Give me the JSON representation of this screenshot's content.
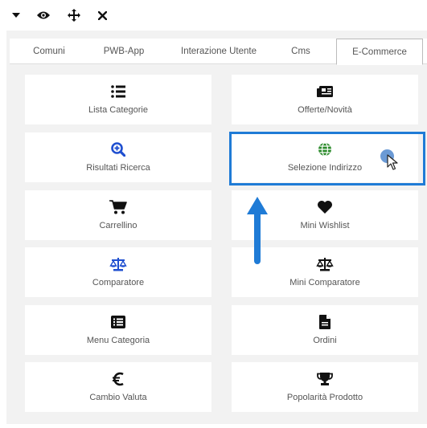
{
  "toolbar": {
    "icons": [
      "caret-down-icon",
      "eye-icon",
      "move-icon",
      "close-icon"
    ]
  },
  "tabs": [
    {
      "label": "Comuni"
    },
    {
      "label": "PWB-App"
    },
    {
      "label": "Interazione Utente"
    },
    {
      "label": "Cms"
    },
    {
      "label": "E-Commerce",
      "active": true
    }
  ],
  "tiles": [
    {
      "label": "Lista Categorie",
      "icon": "list-icon"
    },
    {
      "label": "Offerte/Novità",
      "icon": "newspaper-icon"
    },
    {
      "label": "Risultati Ricerca",
      "icon": "search-plus-icon"
    },
    {
      "label": "Selezione Indirizzo",
      "icon": "globe-icon"
    },
    {
      "label": "Carrellino",
      "icon": "cart-icon"
    },
    {
      "label": "Mini Wishlist",
      "icon": "heart-icon"
    },
    {
      "label": "Comparatore",
      "icon": "balance-scale-icon"
    },
    {
      "label": "Mini Comparatore",
      "icon": "balance-scale-icon"
    },
    {
      "label": "Menu Categoria",
      "icon": "list-alt-icon"
    },
    {
      "label": "Ordini",
      "icon": "file-icon"
    },
    {
      "label": "Cambio Valuta",
      "icon": "euro-icon"
    },
    {
      "label": "Popolarità Prodotto",
      "icon": "trophy-icon"
    }
  ],
  "colors": {
    "accent_blue": "#1f7bd6",
    "icon_blue": "#1f4fd0",
    "icon_green": "#2a8a2a",
    "icon_dark": "#111111"
  }
}
